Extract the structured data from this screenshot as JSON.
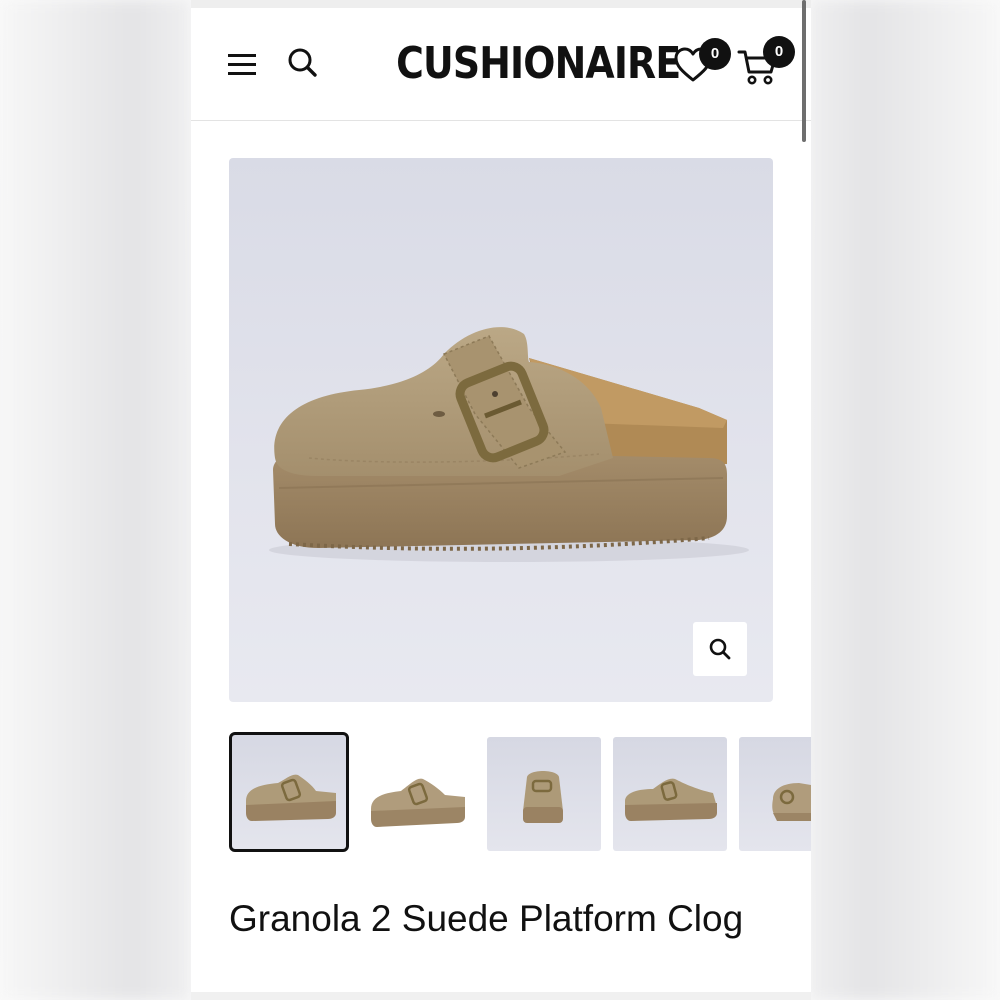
{
  "header": {
    "logo_text": "CUSHIONAIRE",
    "menu_icon": "hamburger-menu-icon",
    "search_icon": "search-icon",
    "wishlist_icon": "heart-icon",
    "wishlist_count": "0",
    "cart_icon": "cart-icon",
    "cart_count": "0"
  },
  "product": {
    "title": "Granola 2 Suede Platform Clog",
    "main_image_alt": "Granola 2 Suede Platform Clog",
    "zoom_icon": "zoom-search-icon",
    "thumbnail_count_visible": 5,
    "selected_thumbnail": 1
  },
  "colors": {
    "text": "#111111",
    "badge_bg": "#111111",
    "image_bg": "#dfe0ea",
    "suede": "#b09c7c",
    "sole": "#9c8565",
    "cork": "#b08a55",
    "buckle": "#7c6a3e"
  }
}
